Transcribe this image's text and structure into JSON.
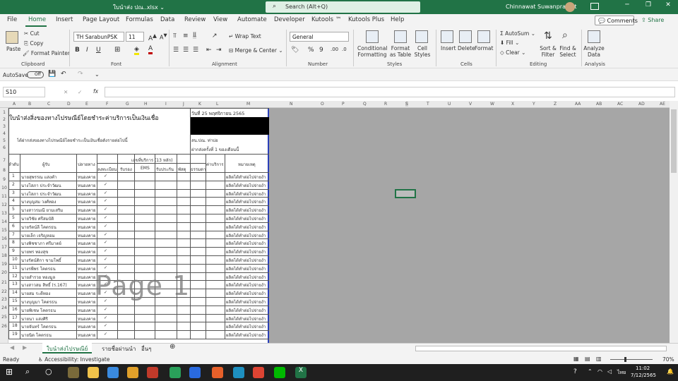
{
  "titlebar": {
    "filename": "ใบนำส่ง ปณ..xlsx ⌄",
    "search_placeholder": "Search (Alt+Q)",
    "user": "Chinnawat Suwanprasert"
  },
  "menu": {
    "tabs": [
      "File",
      "Home",
      "Insert",
      "Page Layout",
      "Formulas",
      "Data",
      "Review",
      "View",
      "Automate",
      "Developer",
      "Kutools ™",
      "Kutools Plus",
      "Help"
    ],
    "comments": "Comments",
    "share": "Share"
  },
  "ribbon": {
    "clipboard": {
      "paste": "Paste",
      "cut": "Cut",
      "copy": "Copy",
      "format_painter": "Format Painter",
      "label": "Clipboard"
    },
    "font": {
      "name": "TH SarabunPSK",
      "size": "11",
      "label": "Font"
    },
    "alignment": {
      "wrap": "Wrap Text",
      "merge": "Merge & Center",
      "label": "Alignment"
    },
    "number": {
      "format": "General",
      "label": "Number"
    },
    "styles": {
      "conditional": "Conditional Formatting",
      "format_table": "Format as Table",
      "cell_styles": "Cell Styles",
      "label": "Styles"
    },
    "cells": {
      "insert": "Insert",
      "delete": "Delete",
      "format": "Format",
      "label": "Cells"
    },
    "editing": {
      "autosum": "AutoSum",
      "fill": "Fill",
      "clear": "Clear",
      "sort": "Sort & Filter",
      "find": "Find & Select",
      "label": "Editing"
    },
    "analysis": {
      "analyze": "Analyze Data",
      "label": "Analysis"
    }
  },
  "qat": {
    "autosave": "AutoSave",
    "toggle": "Off"
  },
  "formula": {
    "namebox": "S10",
    "fx": "fx",
    "value": ""
  },
  "columns": [
    "A",
    "B",
    "C",
    "D",
    "E",
    "F",
    "G",
    "H",
    "I",
    "J",
    "K",
    "L",
    "M",
    "N",
    "O",
    "P",
    "Q",
    "R",
    "S",
    "T",
    "U",
    "V",
    "W",
    "X",
    "Y",
    "Z",
    "AA",
    "AB",
    "AC",
    "AD",
    "AE"
  ],
  "rows": [
    "1",
    "2",
    "3",
    "4",
    "5",
    "6",
    "7",
    "8",
    "9",
    "10",
    "11",
    "12",
    "13",
    "14",
    "15",
    "16",
    "17",
    "18",
    "19",
    "20",
    "21",
    "22",
    "23",
    "24",
    "25",
    "26"
  ],
  "form": {
    "title": "ใบนำส่งสิ่งของทางไปรษณีย์โดยชำระค่าบริการเป็นเงินเชื่อ",
    "date": "วันที่ 25 พฤศจิกายน 2565",
    "note": "ได้ฝากส่งของทางไปรษณีย์โดยชำระเป็นเงินเชื่อดังรายต่อไปนี้",
    "office": "สน.ปณ. ท่าบ่อ",
    "sender": "ฝากส่งครั้งที่ 1 ของเดือนนี้",
    "h_no": "ลำดับ",
    "h_recipient": "ผู้รับ",
    "h_dest": "ปลายทาง",
    "h_service": "เลขที่บริการ (13 หลัก)",
    "h_reg": "ลงทะเบียน",
    "h_ack": "รับรอง",
    "h_ems": "EMS",
    "h_ins": "รับประกัน",
    "h_parcel": "พัสดุ",
    "h_normal": "ธรรมดา",
    "h_fee": "ค่าบริการ",
    "h_remark": "หมายเหตุ",
    "rows": [
      {
        "no": "1",
        "name": "นายสุพรรณ  แสงคำ",
        "dest": "หนองคาย",
        "check": "✓",
        "remark": "ผลิตได้ทำต่อไปจ่ายงำ"
      },
      {
        "no": "2",
        "name": "นางโสภา  ประจำวัฒน",
        "dest": "หนองคาย",
        "check": "✓",
        "remark": "ผลิตได้ทำต่อไปจ่ายงำ"
      },
      {
        "no": "3",
        "name": "นางโสภา  ประจำวัฒน",
        "dest": "หนองคาย",
        "check": "✓",
        "remark": "ผลิตได้ทำต่อไปจ่ายงำ"
      },
      {
        "no": "4",
        "name": "นางบุญสม  วงศ์ทอง",
        "dest": "หนองคาย",
        "check": "✓",
        "remark": "ผลิตได้ทำต่อไปจ่ายงำ"
      },
      {
        "no": "5",
        "name": "นางสาวรมณี  ยามเสริม",
        "dest": "หนองคาย",
        "check": "✓",
        "remark": "ผลิตได้ทำต่อไปจ่ายงำ"
      },
      {
        "no": "5",
        "name": "นายวิชัย  ศรีสมบัติ",
        "dest": "หนองคาย",
        "check": "✓",
        "remark": "ผลิตได้ทำต่อไปจ่ายงำ"
      },
      {
        "no": "6",
        "name": "นายรัตน์ลี  โคตรธน",
        "dest": "หนองคาย",
        "check": "✓",
        "remark": "ผลิตได้ทำต่อไปจ่ายงำ"
      },
      {
        "no": "7",
        "name": "นายเล็ก  เจริญหอม",
        "dest": "หนองคาย",
        "check": "✓",
        "remark": "ผลิตได้ทำต่อไปจ่ายงำ"
      },
      {
        "no": "8",
        "name": "นางพิชชาภา  ศรีมาตย์",
        "dest": "หนองคาย",
        "check": "✓",
        "remark": "ผลิตได้ทำต่อไปจ่ายงำ"
      },
      {
        "no": "9",
        "name": "นายพร  ทองสุข",
        "dest": "หนองคาย",
        "check": "✓",
        "remark": "ผลิตได้ทำต่อไปจ่ายงำ"
      },
      {
        "no": "10",
        "name": "นางรัตน์ติกา  ขามโพธิ์",
        "dest": "หนองคาย",
        "check": "✓",
        "remark": "ผลิตได้ทำต่อไปจ่ายงำ"
      },
      {
        "no": "11",
        "name": "นางรพีพร  โคตรธน",
        "dest": "หนองคาย",
        "check": "✓",
        "remark": "ผลิตได้ทำต่อไปจ่ายงำ"
      },
      {
        "no": "12",
        "name": "นายสำรวย  ทองมูล",
        "dest": "หนองคาย",
        "check": "✓",
        "remark": "ผลิตได้ทำต่อไปจ่ายงำ"
      },
      {
        "no": "13",
        "name": "นางสาวสม  สิทธิ์ (ร.167)",
        "dest": "หนองคาย",
        "check": "✓",
        "remark": "ผลิตได้ทำต่อไปจ่ายงำ"
      },
      {
        "no": "14",
        "name": "นายสม  ระดีทอง",
        "dest": "หนองคาย",
        "check": "✓",
        "remark": "ผลิตได้ทำต่อไปจ่ายงำ"
      },
      {
        "no": "15",
        "name": "นางบุญมา  โคตรธน",
        "dest": "หนองคาย",
        "check": "✓",
        "remark": "ผลิตได้ทำต่อไปจ่ายงำ"
      },
      {
        "no": "16",
        "name": "นายพิเชษ  โคตรธน",
        "dest": "หนองคาย",
        "check": "✓",
        "remark": "ผลิตได้ทำต่อไปจ่ายงำ"
      },
      {
        "no": "17",
        "name": "นายนา  แสงศิริ",
        "dest": "หนองคาย",
        "check": "✓",
        "remark": "ผลิตได้ทำต่อไปจ่ายงำ"
      },
      {
        "no": "18",
        "name": "นายจันทร์  โคตรธน",
        "dest": "หนองคาย",
        "check": "✓",
        "remark": "ผลิตได้ทำต่อไปจ่ายงำ"
      },
      {
        "no": "19",
        "name": "นายนิด  โคตรธน",
        "dest": "หนองคาย",
        "check": "✓",
        "remark": "ผลิตได้ทำต่อไปจ่ายงำ"
      }
    ]
  },
  "watermark": "Page 1",
  "sheets": [
    "ใบนำส่งไปรษณีย์",
    "รายชื่อผ่านนำ",
    "อื่นๆ"
  ],
  "status": {
    "ready": "Ready",
    "accessibility": "Accessibility: Investigate",
    "zoom": "70%"
  },
  "taskbar": {
    "lang": "ไทย",
    "time": "11:02",
    "date": "7/12/2565"
  }
}
